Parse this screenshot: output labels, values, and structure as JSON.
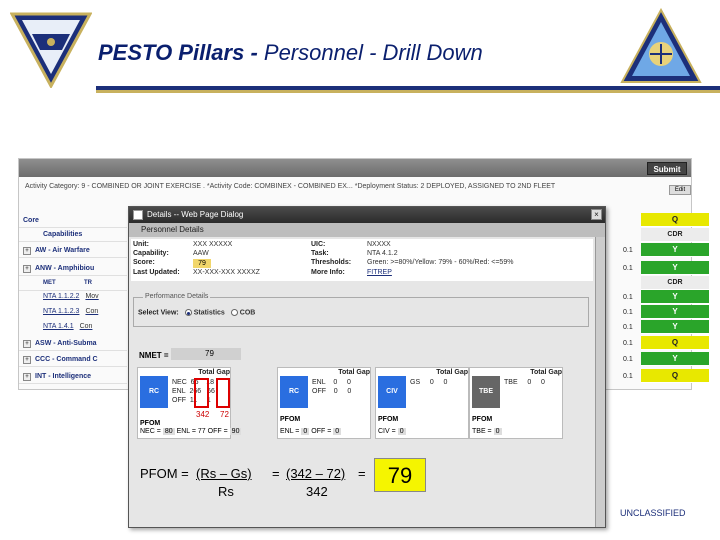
{
  "header": {
    "title_bold": "PESTO Pillars -",
    "title_rest": " Personnel - Drill Down"
  },
  "app": {
    "submit_label": "Submit",
    "edit_label": "Edit",
    "filter_text": "Activity Category: 9 - COMBINED OR JOINT EXERCISE .  *Activity Code: COMBINEX - COMBINED EX...  *Deployment Status: 2  DEPLOYED, ASSIGNED TO 2ND FLEET",
    "rows": [
      {
        "label": "Core",
        "stat": "",
        "cell": "Q",
        "color": "y"
      },
      {
        "label": "Capabilities",
        "stat": "",
        "cell": "CDR",
        "color": "h"
      },
      {
        "label": "AW - Air Warfare",
        "stat": "0.1",
        "cell": "Y",
        "color": "g"
      },
      {
        "label": "ANW - Amphibiou",
        "stat": "0.1",
        "cell": "Y",
        "color": "g"
      },
      {
        "label": "",
        "stat": "",
        "cell": "CDR",
        "color": "h"
      },
      {
        "label": "",
        "stat": "0.1",
        "cell": "Y",
        "color": "g"
      },
      {
        "label": "",
        "stat": "0.1",
        "cell": "Y",
        "color": "g"
      },
      {
        "label": "",
        "stat": "0.1",
        "cell": "Y",
        "color": "g"
      },
      {
        "label": "ASW - Anti-Subma",
        "stat": "0.1",
        "cell": "Q",
        "color": "y"
      },
      {
        "label": "CCC - Command C",
        "stat": "0.1",
        "cell": "Y",
        "color": "g"
      },
      {
        "label": "INT - Intelligence",
        "stat": "0.1",
        "cell": "Q",
        "color": "y"
      }
    ],
    "sub_rows": [
      {
        "label": "NTA 1.1.2.2",
        "tail": "Mov"
      },
      {
        "label": "NTA 1.1.2.3",
        "tail": "Con"
      },
      {
        "label": "NTA 1.4.1",
        "tail": "Con"
      }
    ],
    "sub_header": {
      "met": "MET",
      "tr": "TR"
    }
  },
  "dialog": {
    "title": "Details -- Web Page Dialog",
    "close": "×",
    "subtitle": "Personnel Details",
    "unit_label": "Unit:",
    "unit_value": "XXX XXXXX",
    "capability_label": "Capability:",
    "capability_value": "AAW",
    "score_label": "Score:",
    "score_value": "79",
    "last_updated_label": "Last Updated:",
    "last_updated_value": "XX-XXX-XXX XXXXZ",
    "uic_label": "UIC:",
    "uic_value": "NXXXX",
    "task_label": "Task:",
    "task_value": "NTA 4.1.2",
    "thresholds_label": "Thresholds:",
    "thresholds_value": "Green: >=80%/Yellow: 79% - 60%/Red: <=59%",
    "more_info_label": "More Info:",
    "more_info_value": "FITREP",
    "perf_legend": "Performance Details",
    "select_view_label": "Select View:",
    "view_statistics": "Statistics",
    "view_cob": "COB",
    "nmet_label": "NMET =",
    "nmet_value": "79",
    "cards": [
      {
        "tag": "RC",
        "tag_color": "#2a6ee0",
        "head": "Total Gap",
        "rows": [
          [
            "NEC",
            "66",
            "18"
          ],
          [
            "ENL",
            "266",
            "66"
          ],
          [
            "OFF",
            "11",
            "1"
          ]
        ],
        "pfom": "PFOM",
        "pfom_line": "NEC =",
        "pfom_v1": "80",
        "pfom_mid": "ENL = 77",
        "pfom_off": "OFF =",
        "pfom_v2": "90"
      },
      {
        "tag": "RC",
        "tag_color": "#2a6ee0",
        "head": "Total Gap",
        "rows": [
          [
            "ENL",
            "0",
            "0"
          ],
          [
            "OFF",
            "0",
            "0"
          ]
        ],
        "pfom": "PFOM",
        "pfom_line": "ENL =",
        "pfom_v1": "0",
        "pfom_off": "OFF =",
        "pfom_v2": "0"
      },
      {
        "tag": "CIV",
        "tag_color": "#2a6ee0",
        "head": "Total Gap",
        "rows": [
          [
            "GS",
            "0",
            "0"
          ]
        ],
        "pfom": "PFOM",
        "pfom_line": "CIV =",
        "pfom_v1": "0"
      },
      {
        "tag": "TBE",
        "tag_color": "#666666",
        "head": "Total Gap",
        "rows": [
          [
            "TBE",
            "0",
            "0"
          ]
        ],
        "pfom": "PFOM",
        "pfom_line": "TBE =",
        "pfom_v1": "0"
      }
    ],
    "note_342": "342",
    "note_72": "72"
  },
  "formula": {
    "lhs": "PFOM = ",
    "num": "(Rs – Gs)",
    "den": "Rs",
    "eq1": "=",
    "num2": "(342 – 72)",
    "den2": "342",
    "eq2": "=",
    "result": "79"
  },
  "footer": {
    "classification": "UNCLASSIFIED"
  }
}
